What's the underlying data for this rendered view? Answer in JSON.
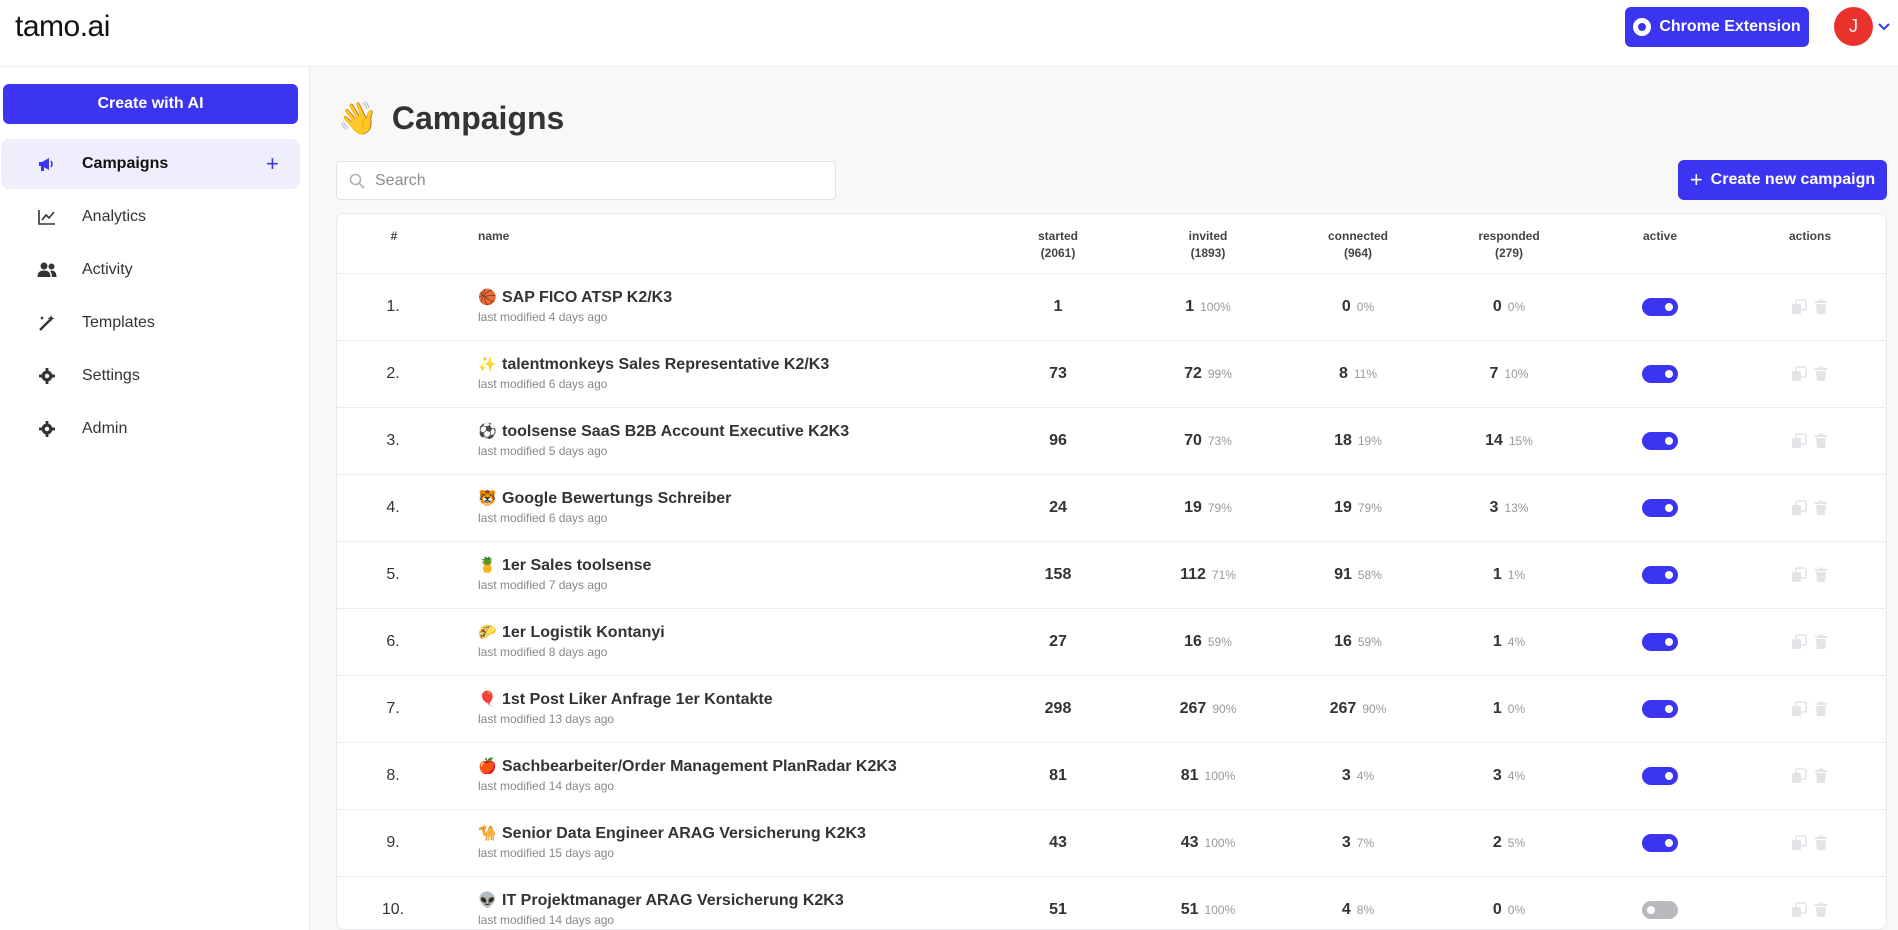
{
  "app": {
    "logo": "tamo.ai",
    "chrome_extension_label": "Chrome Extension",
    "avatar_initial": "J"
  },
  "sidebar": {
    "create_label": "Create with AI",
    "items": [
      {
        "label": "Campaigns",
        "icon": "megaphone-icon",
        "active": true
      },
      {
        "label": "Analytics",
        "icon": "chart-line-icon"
      },
      {
        "label": "Activity",
        "icon": "users-icon"
      },
      {
        "label": "Templates",
        "icon": "magic-wand-icon"
      },
      {
        "label": "Settings",
        "icon": "gear-icon"
      },
      {
        "label": "Admin",
        "icon": "gear-icon"
      }
    ]
  },
  "main": {
    "title_emoji": "👋",
    "title": "Campaigns",
    "search_placeholder": "Search",
    "new_campaign_label": "Create new campaign"
  },
  "table": {
    "headers": {
      "index": "#",
      "name": "name",
      "started": "started",
      "started_total": "(2061)",
      "invited": "invited",
      "invited_total": "(1893)",
      "connected": "connected",
      "connected_total": "(964)",
      "responded": "responded",
      "responded_total": "(279)",
      "active": "active",
      "actions": "actions"
    },
    "rows": [
      {
        "index": "1.",
        "emoji": "🏀",
        "name": "SAP FICO ATSP K2/K3",
        "modified": "last modified 4 days ago",
        "started": "1",
        "invited": "1",
        "invited_pct": "100%",
        "connected": "0",
        "connected_pct": "0%",
        "responded": "0",
        "responded_pct": "0%",
        "active": true
      },
      {
        "index": "2.",
        "emoji": "✨",
        "name": "talentmonkeys Sales Representative K2/K3",
        "modified": "last modified 6 days ago",
        "started": "73",
        "invited": "72",
        "invited_pct": "99%",
        "connected": "8",
        "connected_pct": "11%",
        "responded": "7",
        "responded_pct": "10%",
        "active": true
      },
      {
        "index": "3.",
        "emoji": "⚽",
        "name": "toolsense SaaS B2B Account Executive K2K3",
        "modified": "last modified 5 days ago",
        "started": "96",
        "invited": "70",
        "invited_pct": "73%",
        "connected": "18",
        "connected_pct": "19%",
        "responded": "14",
        "responded_pct": "15%",
        "active": true
      },
      {
        "index": "4.",
        "emoji": "🐯",
        "name": "Google Bewertungs Schreiber",
        "modified": "last modified 6 days ago",
        "started": "24",
        "invited": "19",
        "invited_pct": "79%",
        "connected": "19",
        "connected_pct": "79%",
        "responded": "3",
        "responded_pct": "13%",
        "active": true
      },
      {
        "index": "5.",
        "emoji": "🍍",
        "name": "1er Sales toolsense",
        "modified": "last modified 7 days ago",
        "started": "158",
        "invited": "112",
        "invited_pct": "71%",
        "connected": "91",
        "connected_pct": "58%",
        "responded": "1",
        "responded_pct": "1%",
        "active": true
      },
      {
        "index": "6.",
        "emoji": "🌮",
        "name": "1er Logistik Kontanyi",
        "modified": "last modified 8 days ago",
        "started": "27",
        "invited": "16",
        "invited_pct": "59%",
        "connected": "16",
        "connected_pct": "59%",
        "responded": "1",
        "responded_pct": "4%",
        "active": true
      },
      {
        "index": "7.",
        "emoji": "🎈",
        "name": "1st Post Liker Anfrage 1er Kontakte",
        "modified": "last modified 13 days ago",
        "started": "298",
        "invited": "267",
        "invited_pct": "90%",
        "connected": "267",
        "connected_pct": "90%",
        "responded": "1",
        "responded_pct": "0%",
        "active": true
      },
      {
        "index": "8.",
        "emoji": "🍎",
        "name": "Sachbearbeiter/Order Management PlanRadar K2K3",
        "modified": "last modified 14 days ago",
        "started": "81",
        "invited": "81",
        "invited_pct": "100%",
        "connected": "3",
        "connected_pct": "4%",
        "responded": "3",
        "responded_pct": "4%",
        "active": true
      },
      {
        "index": "9.",
        "emoji": "🐪",
        "name": "Senior Data Engineer ARAG Versicherung K2K3",
        "modified": "last modified 15 days ago",
        "started": "43",
        "invited": "43",
        "invited_pct": "100%",
        "connected": "3",
        "connected_pct": "7%",
        "responded": "2",
        "responded_pct": "5%",
        "active": true
      },
      {
        "index": "10.",
        "emoji": "👽",
        "name": "IT Projektmanager ARAG Versicherung K2K3",
        "modified": "last modified 14 days ago",
        "started": "51",
        "invited": "51",
        "invited_pct": "100%",
        "connected": "4",
        "connected_pct": "8%",
        "responded": "0",
        "responded_pct": "0%",
        "active": false
      }
    ]
  },
  "colors": {
    "accent": "#3b34f0",
    "avatar": "#e8322b",
    "toggle_off": "#b9b9bd"
  }
}
